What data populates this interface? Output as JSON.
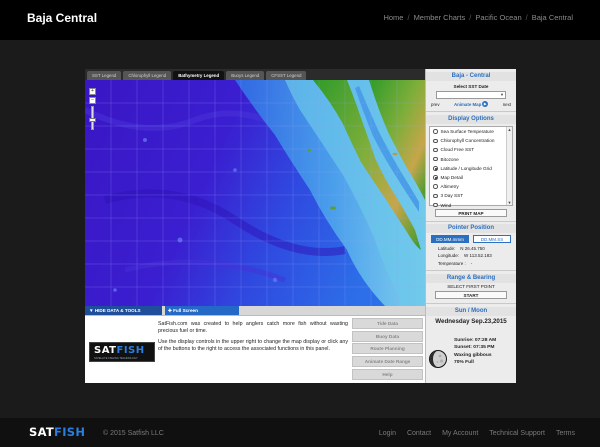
{
  "header": {
    "title": "Baja Central",
    "nav": [
      "Home",
      "Member Charts",
      "Pacific Ocean",
      "Baja Central"
    ]
  },
  "legend_tabs": [
    {
      "label": "SST Legend",
      "active": false
    },
    {
      "label": "Chlorophyll Legend",
      "active": false
    },
    {
      "label": "Bathymetry Legend",
      "active": true
    },
    {
      "label": "Buoys Legend",
      "active": false
    },
    {
      "label": "CFSST Legend",
      "active": false
    }
  ],
  "map": {
    "zoom_in": "+",
    "zoom_out": "−",
    "colors": {
      "deep": "#3418c8",
      "mid": "#2f63ea",
      "shelf": "#67cfe8",
      "land_green": "#3f9a2c",
      "land_tan": "#b89a4a",
      "grid": "#8a8fe0"
    }
  },
  "bottom_tabs": {
    "hide": "▼ HIDE DATA & TOOLS",
    "full_screen": "✚ Full Screen"
  },
  "info": {
    "logo_main_a": "SAT",
    "logo_main_b": "FISH",
    "logo_sub": "SATELLITE FISHING TECHNOLOGY",
    "para1": "SatFish.com was created to help anglers catch more fish without wasting precious fuel or time.",
    "para2": "Use the display controls in the upper right to change the map display or click any of the buttons to the right to access the associated functions in this panel."
  },
  "tool_buttons": [
    "Tide Data",
    "Buoy Data",
    "Route Planning",
    "Animate Date Range",
    "Help"
  ],
  "panel": {
    "region_title": "Baja - Central",
    "select_sst_label": "Select SST Date",
    "prev": "prev",
    "animate": "Animate Map",
    "next": "next",
    "display_title": "Display Options",
    "options": [
      {
        "label": "Sea Surface Temperature",
        "checked": false
      },
      {
        "label": "Chlorophyll Concentration",
        "checked": false
      },
      {
        "label": "Cloud Free SST",
        "checked": false
      },
      {
        "label": "Bitozone",
        "checked": false
      },
      {
        "label": "Latitude / Longitude Grid",
        "checked": true
      },
      {
        "label": "Map Detail",
        "checked": true
      },
      {
        "label": "Altimetry",
        "checked": false
      },
      {
        "label": "3 Day SST",
        "checked": false
      },
      {
        "label": "Wind",
        "checked": false
      }
    ],
    "print_map": "PRINT MAP",
    "pointer_title": "Pointer Position",
    "fmt_a": "DD.MM.mmm",
    "fmt_b": "DD.MM.SS",
    "lat_label": "Latitude:",
    "lat_value": "N 26.45.750",
    "lon_label": "Longitude:",
    "lon_value": "W 113.52.183",
    "temp_label": "Temperature :",
    "temp_value": "-",
    "range_title": "Range & Bearing",
    "select_first_point": "SELECT FIRST POINT",
    "start": "START",
    "sun_moon_title": "Sun / Moon",
    "day": "Wednesday Sep.23,2015",
    "sunrise": "Sunrise: 07:28 AM",
    "sunset": "Sunset: 07:35 PM",
    "moon_phase": "Waxing gibbous",
    "moon_full": "70% Full"
  },
  "footer": {
    "logo_a": "SAT",
    "logo_b": "FISH",
    "copyright": "© 2015 Satfish LLC",
    "links": [
      "Login",
      "Contact",
      "My Account",
      "Technical Support",
      "Terms"
    ]
  }
}
